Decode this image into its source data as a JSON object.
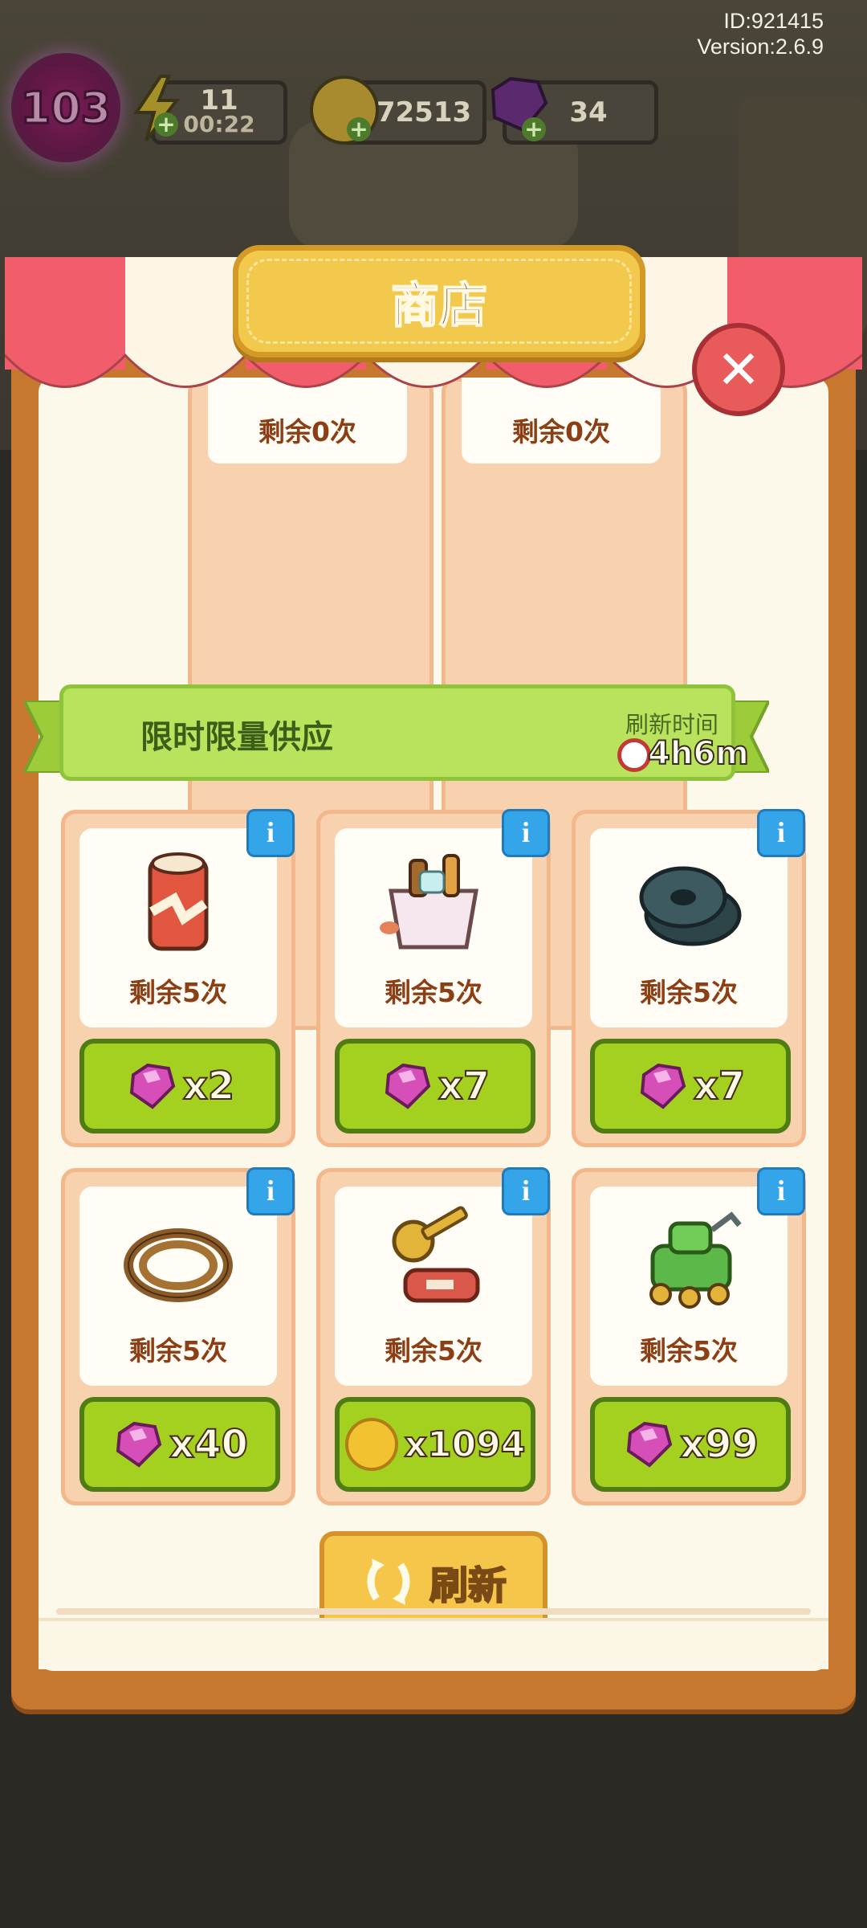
{
  "header": {
    "id_text": "ID:921415",
    "version_text": "Version:2.6.9",
    "level": "103",
    "energy": {
      "value": "11",
      "timer": "00:22"
    },
    "coins": "72513",
    "gems": "34"
  },
  "shop": {
    "title": "商店",
    "top_items": [
      {
        "remaining": "剩余0次"
      },
      {
        "remaining": "剩余0次"
      }
    ],
    "limited": {
      "title": "限时限量供应",
      "refresh_label": "刷新时间",
      "refresh_time": "4h6m"
    },
    "items": [
      {
        "name": "soda-can",
        "remaining": "剩余5次",
        "price": "x2",
        "currency": "gem"
      },
      {
        "name": "ice-bucket",
        "remaining": "剩余5次",
        "price": "x7",
        "currency": "gem"
      },
      {
        "name": "weight-plates",
        "remaining": "剩余5次",
        "price": "x7",
        "currency": "gem"
      },
      {
        "name": "rope-coil",
        "remaining": "剩余5次",
        "price": "x40",
        "currency": "gem"
      },
      {
        "name": "key-tag",
        "remaining": "剩余5次",
        "price": "x1094",
        "currency": "coin"
      },
      {
        "name": "green-robot",
        "remaining": "剩余5次",
        "price": "x99",
        "currency": "gem"
      }
    ],
    "refresh_button": "刷新"
  },
  "colors": {
    "gem": "#d64fb8",
    "coin": "#f2c230",
    "awning_red": "#f25d6c",
    "price_green": "#a4d020"
  }
}
